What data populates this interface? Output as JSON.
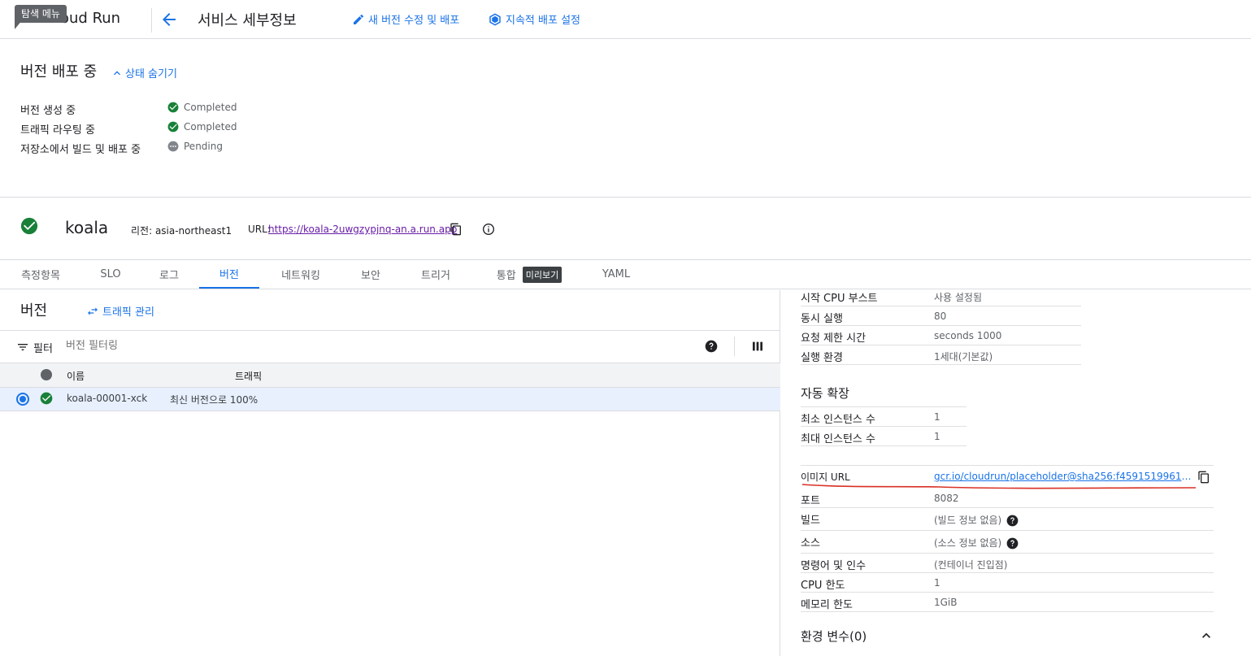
{
  "topbar": {
    "tooltip": "탐색 메뉴",
    "app_name": "oud Run",
    "title": "서비스 세부정보",
    "actions": [
      {
        "label": "새 버전 수정 및 배포",
        "icon": "pencil-icon"
      },
      {
        "label": "지속적 배포 설정",
        "icon": "cube-icon"
      }
    ]
  },
  "deploy_status": {
    "title": "버전 배포 중",
    "toggle": "상태 숨기기",
    "steps": [
      {
        "label": "버전 생성 중",
        "status": "Completed"
      },
      {
        "label": "트래픽 라우팅 중",
        "status": "Completed"
      },
      {
        "label": "저장소에서 빌드 및 배포 중",
        "status": "Pending"
      }
    ]
  },
  "service": {
    "name": "koala",
    "region_label": "리전: asia-northeast1",
    "url_label": "URL:",
    "url": "https://koala-2uwgzypjnq-an.a.run.app"
  },
  "tabs": [
    {
      "label": "측정항목"
    },
    {
      "label": "SLO"
    },
    {
      "label": "로그"
    },
    {
      "label": "버전",
      "active": true
    },
    {
      "label": "네트워킹"
    },
    {
      "label": "보안"
    },
    {
      "label": "트리거"
    },
    {
      "label": "통합",
      "badge": "미리보기"
    },
    {
      "label": "YAML"
    }
  ],
  "revisions": {
    "title": "버전",
    "manage_traffic": "트래픽 관리",
    "filter_label": "필터",
    "filter_placeholder": "버전 필터링",
    "columns": {
      "name": "이름",
      "traffic": "트래픽"
    },
    "rows": [
      {
        "name": "koala-00001-xck",
        "traffic": "최신 버전으로 100%"
      }
    ]
  },
  "details": {
    "container": [
      {
        "label": "시작 CPU 부스트",
        "value": "사용 설정됨"
      },
      {
        "label": "동시 실행",
        "value": "80"
      },
      {
        "label": "요청 제한 시간",
        "value": "seconds 1000"
      },
      {
        "label": "실행 환경",
        "value": "1세대(기본값)"
      }
    ],
    "autoscaling_title": "자동 확장",
    "autoscaling": [
      {
        "label": "최소 인스턴스 수",
        "value": "1"
      },
      {
        "label": "최대 인스턴스 수",
        "value": "1"
      }
    ],
    "image_url_label": "이미지 URL",
    "image_url": "gcr.io/cloudrun/placeholder@sha256:f4591519961e8…",
    "port_label": "포트",
    "port": "8082",
    "build_label": "빌드",
    "build": "(빌드 정보 없음)",
    "source_label": "소스",
    "source": "(소스 정보 없음)",
    "command_label": "명령어 및 인수",
    "command": "(컨테이너 진입점)",
    "cpu_label": "CPU 한도",
    "cpu": "1",
    "memory_label": "메모리 한도",
    "memory": "1GiB",
    "env_title": "환경 변수(0)"
  },
  "colors": {
    "accent": "#1a73e8",
    "success": "#188038",
    "annotation": "#d93025"
  }
}
